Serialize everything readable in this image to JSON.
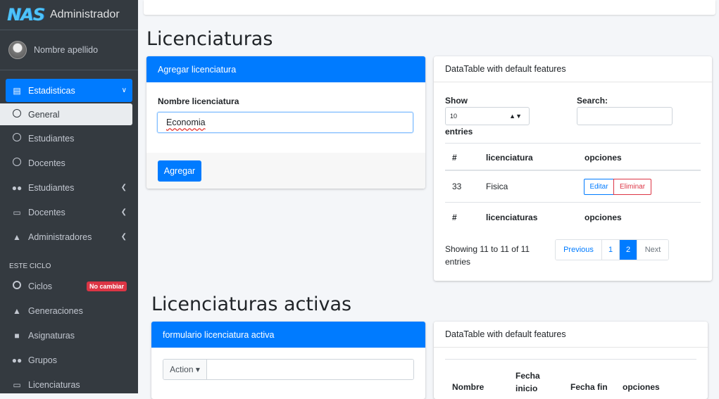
{
  "brand": {
    "logo": "NAS",
    "title": "Administrador"
  },
  "user": {
    "name": "Nombre apellido"
  },
  "sidebar": {
    "items": [
      {
        "label": "Estadisticas",
        "icon": "chart-icon"
      },
      {
        "label": "General",
        "icon": "circle-icon"
      },
      {
        "label": "Estudiantes",
        "icon": "circle-icon"
      },
      {
        "label": "Docentes",
        "icon": "circle-icon"
      },
      {
        "label": "Estudiantes",
        "icon": "users-icon"
      },
      {
        "label": "Docentes",
        "icon": "chalkboard-icon"
      },
      {
        "label": "Administradores",
        "icon": "user-tie-icon"
      }
    ],
    "section_header": "ESTE CICLO",
    "cycle_items": [
      {
        "label": "Ciclos",
        "icon": "circle-icon",
        "badge": "No cambiar"
      },
      {
        "label": "Generaciones",
        "icon": "graduation-cap-icon"
      },
      {
        "label": "Asignaturas",
        "icon": "book-icon"
      },
      {
        "label": "Grupos",
        "icon": "users-icon"
      },
      {
        "label": "Licenciaturas",
        "icon": "chalkboard-teacher-icon"
      }
    ]
  },
  "page": {
    "title": "Licenciaturas",
    "title2": "Licenciaturas activas"
  },
  "add_form": {
    "header": "Agregar licenciatura",
    "field_label": "Nombre licenciatura",
    "field_value": "Economia",
    "submit_label": "Agregar"
  },
  "datatable1": {
    "header": "DataTable with default features",
    "show_label": "Show",
    "page_size": "10",
    "entries_label": "entries",
    "search_label": "Search:",
    "columns": [
      "#",
      "licenciatura",
      "opciones"
    ],
    "footer_columns": [
      "#",
      "licenciaturas",
      "opciones"
    ],
    "rows": [
      {
        "id": "33",
        "name": "Fisica"
      }
    ],
    "edit_label": "Editar",
    "delete_label": "Eliminar",
    "info": "Showing 11 to 11 of 11 entries",
    "pager": {
      "prev": "Previous",
      "pages": [
        "1",
        "2"
      ],
      "next": "Next"
    }
  },
  "active_form": {
    "header": "formulario licenciatura activa",
    "action_label": "Action ▾"
  },
  "datatable2": {
    "header": "DataTable with default features",
    "columns": [
      "Nombre",
      "Fecha inicio",
      "Fecha fin",
      "opciones"
    ]
  },
  "colors": {
    "primary": "#007bff",
    "sidebar": "#343a40",
    "danger": "#dc3545"
  }
}
